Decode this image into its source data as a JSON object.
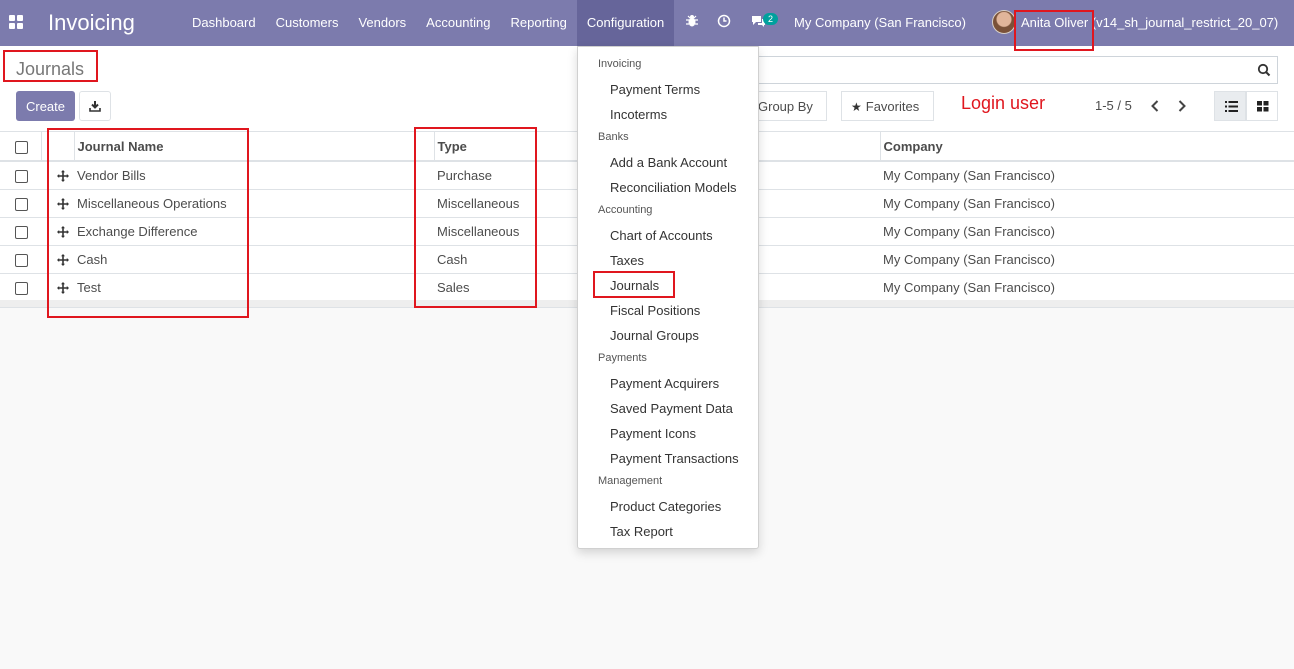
{
  "navbar": {
    "brand": "Invoicing",
    "menu": [
      "Dashboard",
      "Customers",
      "Vendors",
      "Accounting",
      "Reporting",
      "Configuration"
    ],
    "chat_count": "2",
    "company": "My Company (San Francisco)",
    "user": "Anita Oliver (v14_sh_journal_restrict_20_07)",
    "bg_color": "#7c7bad"
  },
  "control_panel": {
    "breadcrumb": "Journals",
    "create_label": "Create",
    "search_placeholder": "",
    "group_by_label": "Group By",
    "favorites_label": "Favorites",
    "pager_value": "1-5 / 5"
  },
  "annotation": {
    "login_user": "Login user"
  },
  "table": {
    "columns": {
      "name": "Journal Name",
      "type": "Type",
      "company": "Company"
    },
    "rows": [
      {
        "name": "Vendor Bills",
        "type": "Purchase",
        "company": "My Company (San Francisco)"
      },
      {
        "name": "Miscellaneous Operations",
        "type": "Miscellaneous",
        "company": "My Company (San Francisco)"
      },
      {
        "name": "Exchange Difference",
        "type": "Miscellaneous",
        "company": "My Company (San Francisco)"
      },
      {
        "name": "Cash",
        "type": "Cash",
        "company": "My Company (San Francisco)"
      },
      {
        "name": "Test",
        "type": "Sales",
        "company": "My Company (San Francisco)"
      }
    ]
  },
  "dropdown": {
    "sections": [
      {
        "header": "Invoicing",
        "items": [
          "Payment Terms",
          "Incoterms"
        ]
      },
      {
        "header": "Banks",
        "items": [
          "Add a Bank Account",
          "Reconciliation Models"
        ]
      },
      {
        "header": "Accounting",
        "items": [
          "Chart of Accounts",
          "Taxes",
          "Journals",
          "Fiscal Positions",
          "Journal Groups"
        ]
      },
      {
        "header": "Payments",
        "items": [
          "Payment Acquirers",
          "Saved Payment Data",
          "Payment Icons",
          "Payment Transactions"
        ]
      },
      {
        "header": "Management",
        "items": [
          "Product Categories",
          "Tax Report"
        ]
      }
    ]
  },
  "icons": {
    "apps": "apps-grid-icon",
    "bug": "bug-icon",
    "clock": "clock-icon",
    "chat": "chat-icon",
    "export": "download-icon",
    "search": "search-icon",
    "star": "star-icon",
    "prev": "chevron-left-icon",
    "next": "chevron-right-icon",
    "list_view": "list-view-icon",
    "kanban_view": "kanban-view-icon",
    "drag": "drag-handle-icon"
  },
  "accent_color": "#e0161e"
}
